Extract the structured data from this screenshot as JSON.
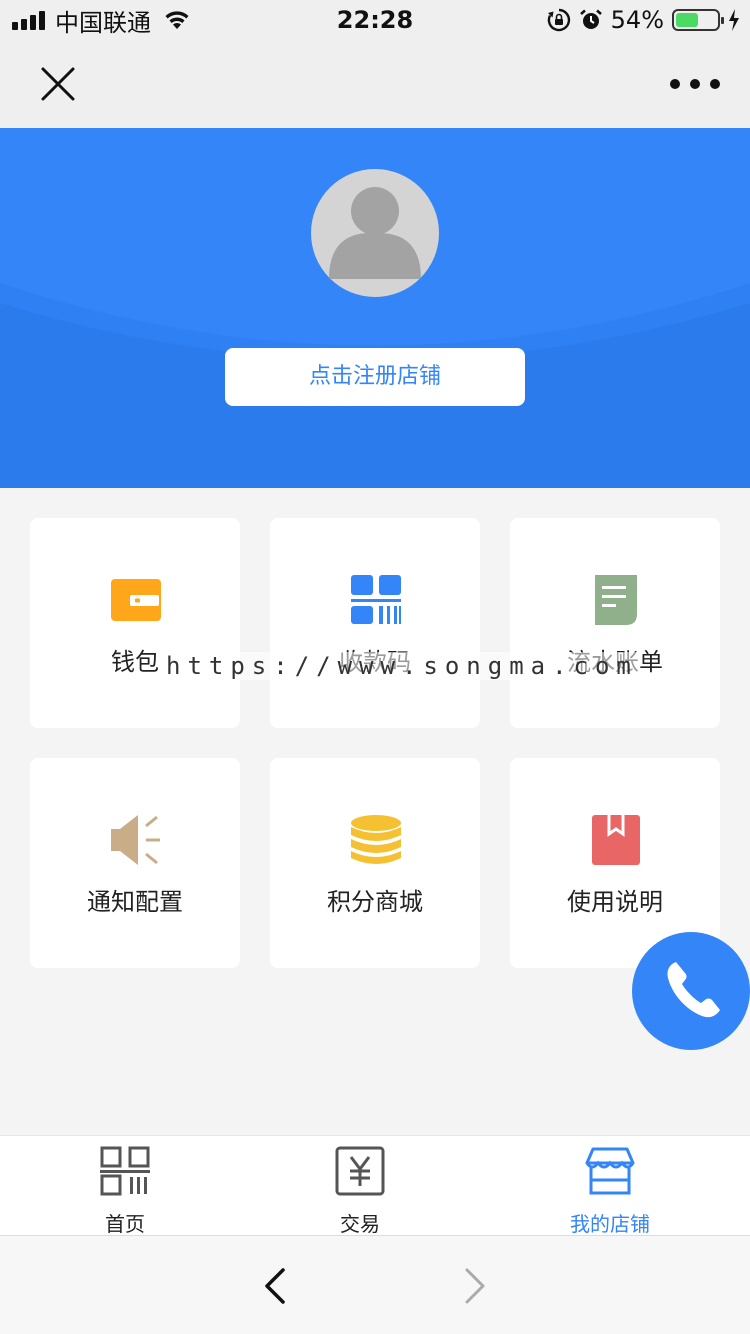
{
  "status_bar": {
    "carrier": "中国联通",
    "time": "22:28",
    "battery_percent": "54%",
    "battery_level": 0.54,
    "icons": [
      "signal-icon",
      "wifi-icon",
      "rotation-lock-icon",
      "alarm-icon",
      "battery-icon",
      "charging-icon"
    ]
  },
  "nav_bar": {
    "icons": [
      "close-icon",
      "more-icon"
    ]
  },
  "header": {
    "register_button": "点击注册店铺",
    "colors": {
      "background": "#3385f8",
      "avatar_bg": "#d4d4d4"
    }
  },
  "grid": {
    "items": [
      {
        "label": "钱包",
        "icon": "wallet-icon",
        "color": "#ffa61a"
      },
      {
        "label": "收款码",
        "icon": "qr-code-icon",
        "color": "#3385f8"
      },
      {
        "label": "流水账单",
        "icon": "bill-icon",
        "color": "#8fb08a"
      },
      {
        "label": "通知配置",
        "icon": "speaker-icon",
        "color": "#c8ad88"
      },
      {
        "label": "积分商城",
        "icon": "coins-icon",
        "color": "#f5c133"
      },
      {
        "label": "使用说明",
        "icon": "manual-book-icon",
        "color": "#e86666"
      }
    ]
  },
  "watermark": "https://www.songma.com",
  "fab": {
    "icon": "phone-icon",
    "color": "#3385f8"
  },
  "tab_bar": {
    "tabs": [
      {
        "label": "首页",
        "icon": "qr-home-icon",
        "active": false
      },
      {
        "label": "交易",
        "icon": "yuan-icon",
        "active": false
      },
      {
        "label": "我的店铺",
        "icon": "store-icon",
        "active": true
      }
    ],
    "active_color": "#3385f8"
  },
  "browser_bar": {
    "icons": [
      "back-arrow-icon",
      "forward-arrow-icon"
    ]
  }
}
